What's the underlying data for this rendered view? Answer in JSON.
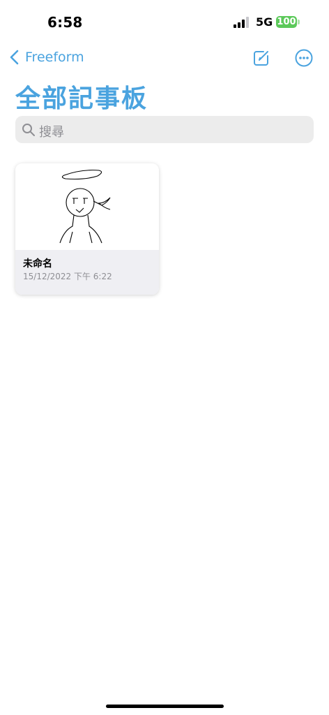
{
  "status_bar": {
    "time": "6:58",
    "network": "5G",
    "battery": "100"
  },
  "nav": {
    "back_label": "Freeform"
  },
  "page_title": "全部記事板",
  "search": {
    "placeholder": "搜尋"
  },
  "boards": [
    {
      "title": "未命名",
      "date": "15/12/2022 下午 6:22"
    }
  ],
  "colors": {
    "accent": "#4aa3df",
    "battery": "#5cc95a",
    "search_bg": "#ececec",
    "card_footer": "#efeff3"
  },
  "icons": [
    "chevron-left-icon",
    "compose-icon",
    "more-icon",
    "search-icon",
    "signal-icon"
  ]
}
